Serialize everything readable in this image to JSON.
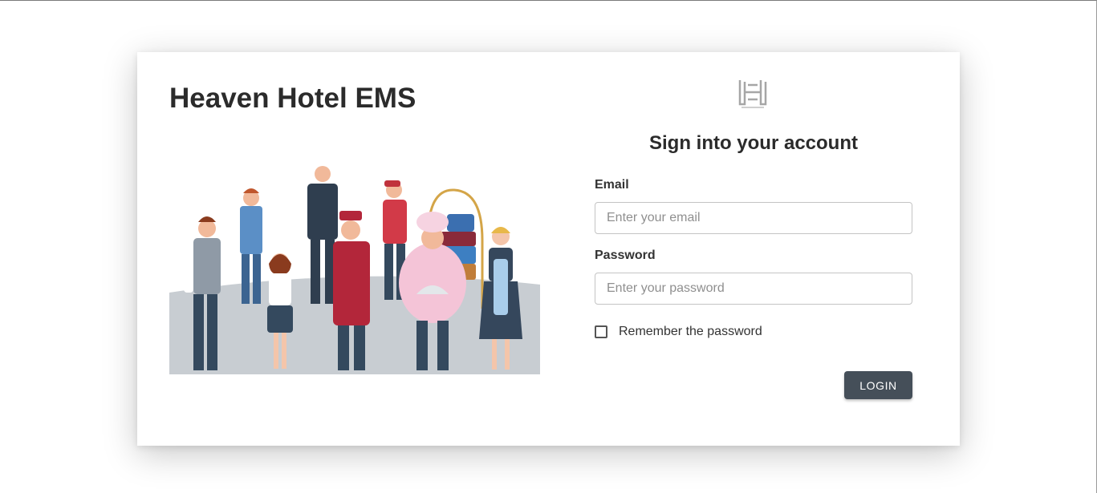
{
  "app": {
    "title": "Heaven Hotel EMS",
    "logo_icon": "heaven-hotel-h-logo"
  },
  "login_form": {
    "heading": "Sign into your account",
    "email_label": "Email",
    "email_placeholder": "Enter your email",
    "email_value": "",
    "password_label": "Password",
    "password_placeholder": "Enter your password",
    "password_value": "",
    "remember_label": "Remember the password",
    "remember_checked": false,
    "login_button_label": "LOGIN"
  },
  "colors": {
    "button_bg": "#454f59",
    "title_text": "#2b2b2b",
    "input_border": "#c4c4c4"
  }
}
